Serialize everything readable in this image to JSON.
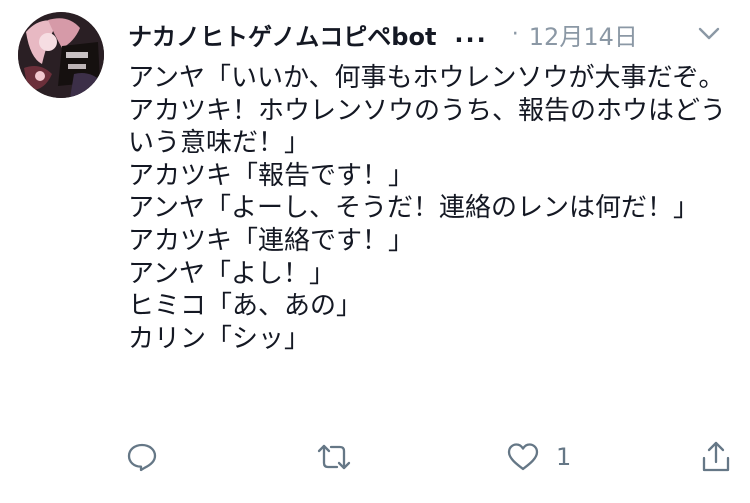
{
  "tweet": {
    "display_name": "ナカノヒトゲノムコピペbot",
    "overflow_ellipsis": "...",
    "separator": "·",
    "date": "12月14日",
    "body_text": "アンヤ「いいか、何事もホウレンソウが大事だぞ。アカツキ！ホウレンソウのうち、報告のホウはどういう意味だ！」\nアカツキ「報告です！」\nアンヤ「よーし、そうだ！連絡のレンは何だ！」\nアカツキ「連絡です！」\nアンヤ「よし！」\nヒミコ「あ、あの」\nカリン「シッ」"
  },
  "actions": {
    "reply_icon": "reply-icon",
    "retweet_icon": "retweet-icon",
    "like_icon": "heart-icon",
    "like_count": "1",
    "share_icon": "share-icon"
  },
  "colors": {
    "text": "#141823",
    "secondary": "#8b98a5",
    "icon": "#657786",
    "background": "#ffffff"
  }
}
